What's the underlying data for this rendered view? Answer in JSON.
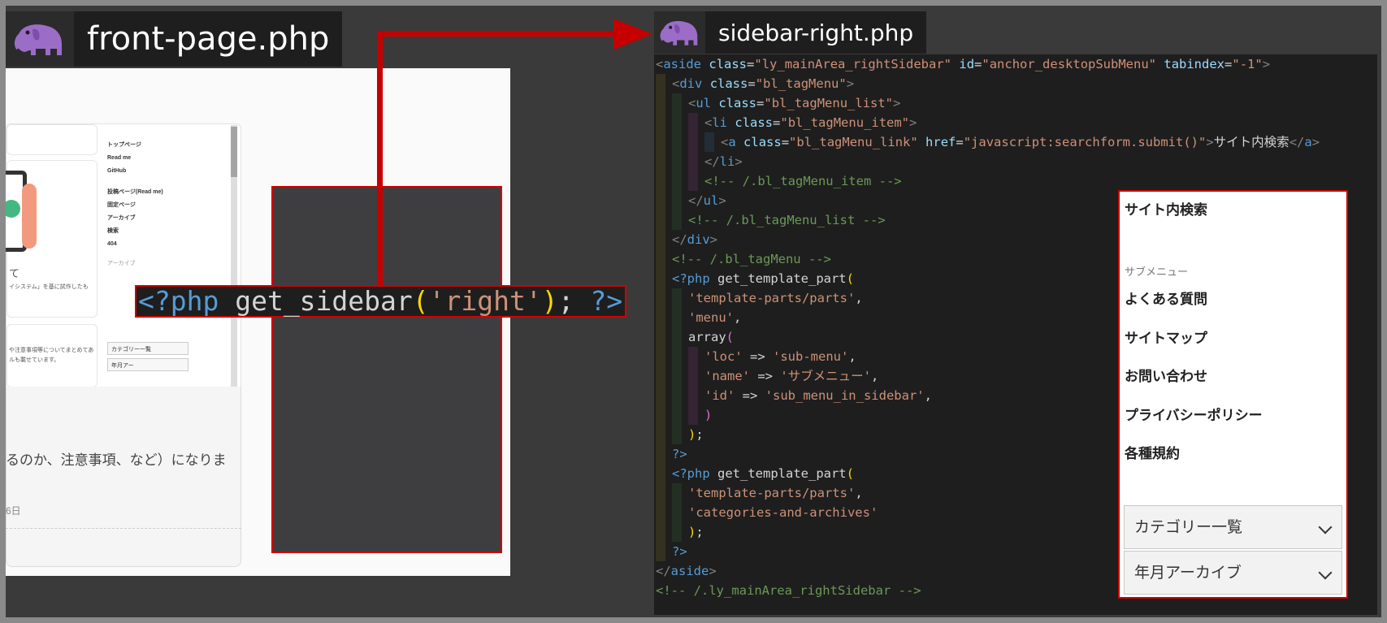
{
  "left_file": {
    "name": "front-page.php",
    "icon": "php-elephant-icon"
  },
  "right_file": {
    "name": "sidebar-right.php",
    "icon": "php-elephant-icon"
  },
  "preview": {
    "menu_items": [
      "トップページ",
      "Read me",
      "GitHub"
    ],
    "menu_items2": [
      "投稿ページ(Read me)",
      "固定ページ",
      "アーカイブ",
      "検索",
      "404"
    ],
    "archive_label": "アーカイブ",
    "select1": "カテゴリー一覧",
    "select2": "年月アー",
    "card_text1": "て",
    "card_text2": "イシステム」を基に試作したも",
    "card_text3": "や注意事項等についてまとめてあ",
    "card_text4": "ルも載せています。",
    "lower_text": "るのか、注意事項、など）になりま",
    "lower_date": "6日"
  },
  "snippet": {
    "open": "<?php",
    "func": " get_sidebar",
    "paren_open": "(",
    "arg": "'right'",
    "paren_close": ")",
    "semi": ";",
    "close": " ?>"
  },
  "code": {
    "l1": [
      "<",
      "aside",
      " ",
      "class",
      "=",
      "\"ly_mainArea_rightSidebar\"",
      " ",
      "id",
      "=",
      "\"anchor_desktopSubMenu\"",
      " ",
      "tabindex",
      "=",
      "\"-1\"",
      ">"
    ],
    "l2": [
      "<",
      "div",
      " ",
      "class",
      "=",
      "\"bl_tagMenu\"",
      ">"
    ],
    "l3": [
      "<",
      "ul",
      " ",
      "class",
      "=",
      "\"bl_tagMenu_list\"",
      ">"
    ],
    "l4": [
      "<",
      "li",
      " ",
      "class",
      "=",
      "\"bl_tagMenu_item\"",
      ">"
    ],
    "l5": [
      "<",
      "a",
      " ",
      "class",
      "=",
      "\"bl_tagMenu_link\"",
      " ",
      "href",
      "=",
      "\"javascript:searchform.submit()\"",
      ">",
      "サイト内検索",
      "</",
      "a",
      ">"
    ],
    "l6": [
      "</",
      "li",
      ">"
    ],
    "l7": "<!-- /.bl_tagMenu_item -->",
    "l8": [
      "</",
      "ul",
      ">"
    ],
    "l9": "<!-- /.bl_tagMenu_list -->",
    "l10": [
      "</",
      "div",
      ">"
    ],
    "l11": "<!-- /.bl_tagMenu -->",
    "l12": [
      "<?php",
      " get_template_part",
      "("
    ],
    "l13": [
      "'template-parts/parts'",
      ","
    ],
    "l14": [
      "'menu'",
      ","
    ],
    "l15": [
      "array",
      "("
    ],
    "l16": [
      "'loc'",
      " => ",
      "'sub-menu'",
      ","
    ],
    "l17": [
      "'name'",
      " => ",
      "'サブメニュー'",
      ","
    ],
    "l18": [
      "'id'",
      " => ",
      "'sub_menu_in_sidebar'",
      ","
    ],
    "l19": ")",
    "l20": [
      ")",
      ";"
    ],
    "l21": "?>",
    "l22": [
      "<?php",
      " get_template_part",
      "("
    ],
    "l23": [
      "'template-parts/parts'",
      ","
    ],
    "l24": "'categories-and-archives'",
    "l25": [
      ")",
      ";"
    ],
    "l26": "?>",
    "l27": [
      "</",
      "aside",
      ">"
    ],
    "l28": "<!-- /.ly_mainArea_rightSidebar -->"
  },
  "sidebar": {
    "search": "サイト内検索",
    "submenu_label": "サブメニュー",
    "items": [
      "よくある質問",
      "サイトマップ",
      "お問い合わせ",
      "プライバシーポリシー",
      "各種規約"
    ],
    "select_category": "カテゴリー一覧",
    "select_archive": "年月アーカイブ"
  },
  "colors": {
    "highlight_border": "#d10000",
    "arrow": "#c60000",
    "code_bg": "#1e1e1e"
  }
}
